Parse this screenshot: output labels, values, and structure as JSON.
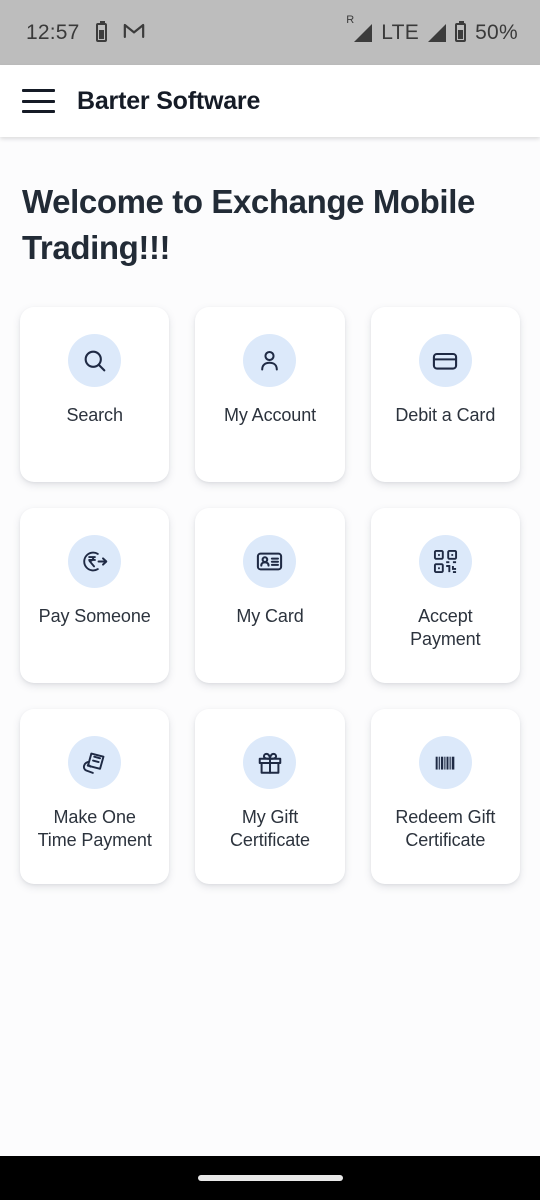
{
  "status_bar": {
    "time": "12:57",
    "battery_icon": "battery-charging-icon",
    "mail_icon": "gmail-icon",
    "roaming_label": "R",
    "network_type": "LTE",
    "battery_percent": "50%",
    "background_color": "#bdbdbd"
  },
  "app_bar": {
    "menu_icon": "hamburger-menu-icon",
    "title": "Barter Software"
  },
  "main": {
    "heading": "Welcome to Exchange Mobile Trading!!!",
    "accent_circle_color": "#dce9fa",
    "icon_color": "#1f2a44",
    "tiles": [
      {
        "label": "Search",
        "icon": "search-icon"
      },
      {
        "label": "My Account",
        "icon": "person-icon"
      },
      {
        "label": "Debit a Card",
        "icon": "credit-card-icon"
      },
      {
        "label": "Pay Someone",
        "icon": "rupee-transfer-icon"
      },
      {
        "label": "My Card",
        "icon": "id-card-icon"
      },
      {
        "label": "Accept\nPayment",
        "icon": "qr-code-icon"
      },
      {
        "label": "Make One\nTime Payment",
        "icon": "cash-in-hand-icon"
      },
      {
        "label": "My Gift\nCertificate",
        "icon": "gift-icon"
      },
      {
        "label": "Redeem Gift\nCertificate",
        "icon": "barcode-icon"
      }
    ]
  },
  "nav_bar": {
    "gesture_handle": "home-gesture-pill"
  }
}
